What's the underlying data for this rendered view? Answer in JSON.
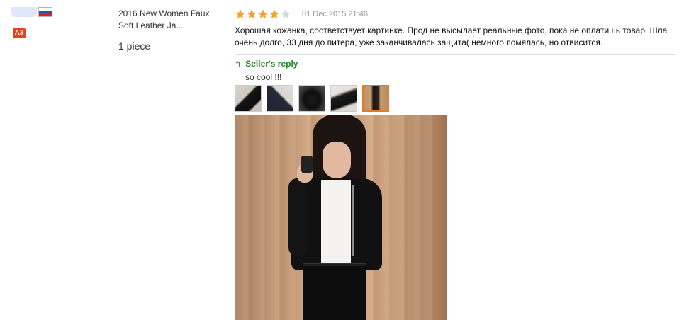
{
  "user": {
    "level_badge": "A3",
    "flag_icon": "russia-flag-icon"
  },
  "product": {
    "title": "2016 New Women Faux Soft Leather Ja...",
    "quantity": "1 piece"
  },
  "review": {
    "rating": 4,
    "rating_max": 5,
    "star_color": "#f7a21c",
    "star_empty_color": "#d6d6d6",
    "date": "01 Dec 2015 21:46",
    "text": "Хорошая кожанка, соответствует картинке. Прод не высылает реальные фото, пока не оплатишь товар. Шла очень долго, 33 дня до питера, уже заканчивалась защита( немного помялась, но отвисится."
  },
  "seller_reply": {
    "heading": "Seller's reply",
    "arrow_icon": "reply-arrow-icon",
    "text": "so cool !!!",
    "accent_color": "#228b22"
  },
  "thumbnails": [
    {
      "name": "thumbnail-1",
      "active": false
    },
    {
      "name": "thumbnail-2",
      "active": false
    },
    {
      "name": "thumbnail-3",
      "active": false
    },
    {
      "name": "thumbnail-4",
      "active": false
    },
    {
      "name": "thumbnail-5",
      "active": true
    }
  ]
}
